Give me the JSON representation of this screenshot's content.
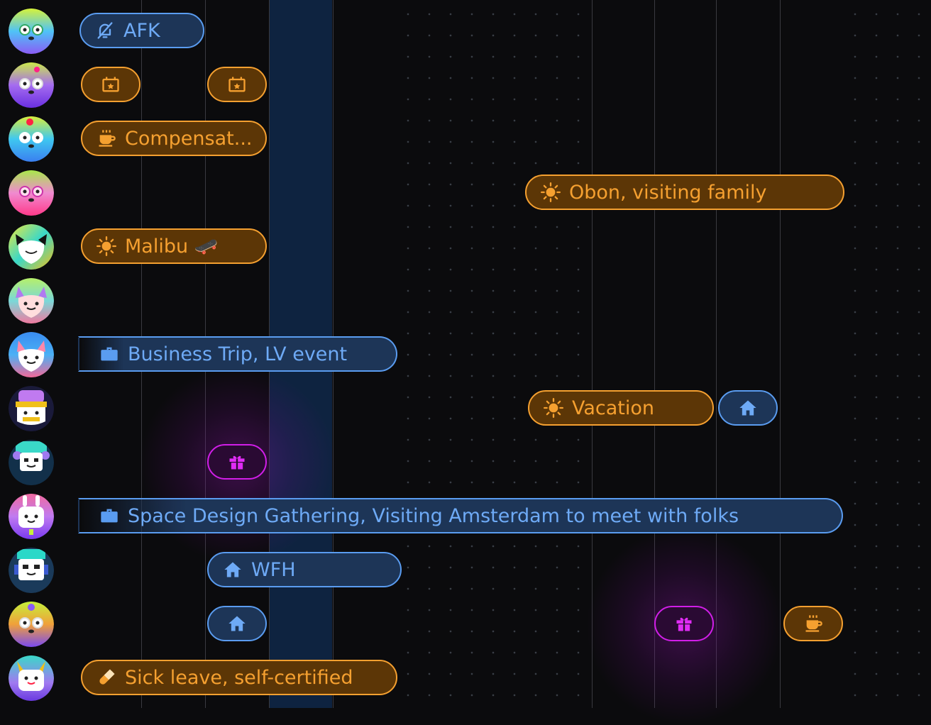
{
  "colors": {
    "accent_orange": "#f5a030",
    "accent_blue": "#6eaaf6",
    "accent_magenta": "#e02cf5",
    "today_column": "#0e2340",
    "background": "#0b0b0d"
  },
  "rows": [
    {
      "avatar": "avatar-blue-glasses",
      "events": [
        {
          "label": "AFK",
          "icon": "bell-off-icon",
          "style": "blue"
        }
      ]
    },
    {
      "avatar": "avatar-purple-glasses",
      "events": [
        {
          "label": "",
          "icon": "calendar-star-icon",
          "style": "orange"
        },
        {
          "label": "",
          "icon": "calendar-star-icon",
          "style": "orange"
        }
      ]
    },
    {
      "avatar": "avatar-cyan-glasses",
      "events": [
        {
          "label": "Compensat...",
          "icon": "coffee-icon",
          "style": "orange"
        }
      ]
    },
    {
      "avatar": "avatar-pink-glasses",
      "events": [
        {
          "label": "Obon, visiting family",
          "icon": "sun-icon",
          "style": "orange"
        }
      ]
    },
    {
      "avatar": "avatar-rainbow-cat",
      "events": [
        {
          "label": "Malibu 🛹",
          "icon": "sun-icon",
          "style": "orange"
        }
      ]
    },
    {
      "avatar": "avatar-green-cat",
      "events": []
    },
    {
      "avatar": "avatar-pink-cat",
      "events": [
        {
          "label": "Business Trip, LV event",
          "icon": "briefcase-icon",
          "style": "blue"
        }
      ]
    },
    {
      "avatar": "avatar-headband",
      "events": [
        {
          "label": "Vacation",
          "icon": "sun-icon",
          "style": "orange"
        },
        {
          "label": "",
          "icon": "home-icon",
          "style": "blue"
        }
      ]
    },
    {
      "avatar": "avatar-robot-teal",
      "events": [
        {
          "label": "",
          "icon": "gift-icon",
          "style": "magenta"
        }
      ]
    },
    {
      "avatar": "avatar-bunny-purple",
      "events": [
        {
          "label": "Space Design Gathering, Visiting Amsterdam to meet with folks",
          "icon": "briefcase-icon",
          "style": "blue"
        }
      ]
    },
    {
      "avatar": "avatar-robot-navy",
      "events": [
        {
          "label": "WFH",
          "icon": "home-icon",
          "style": "blue"
        }
      ]
    },
    {
      "avatar": "avatar-orange-glasses",
      "events": [
        {
          "label": "",
          "icon": "home-icon",
          "style": "blue"
        },
        {
          "label": "",
          "icon": "gift-icon",
          "style": "magenta"
        },
        {
          "label": "",
          "icon": "coffee-icon",
          "style": "orange"
        }
      ]
    },
    {
      "avatar": "avatar-horns-purple",
      "events": [
        {
          "label": "Sick leave, self-certified",
          "icon": "pill-icon",
          "style": "orange"
        }
      ]
    }
  ]
}
